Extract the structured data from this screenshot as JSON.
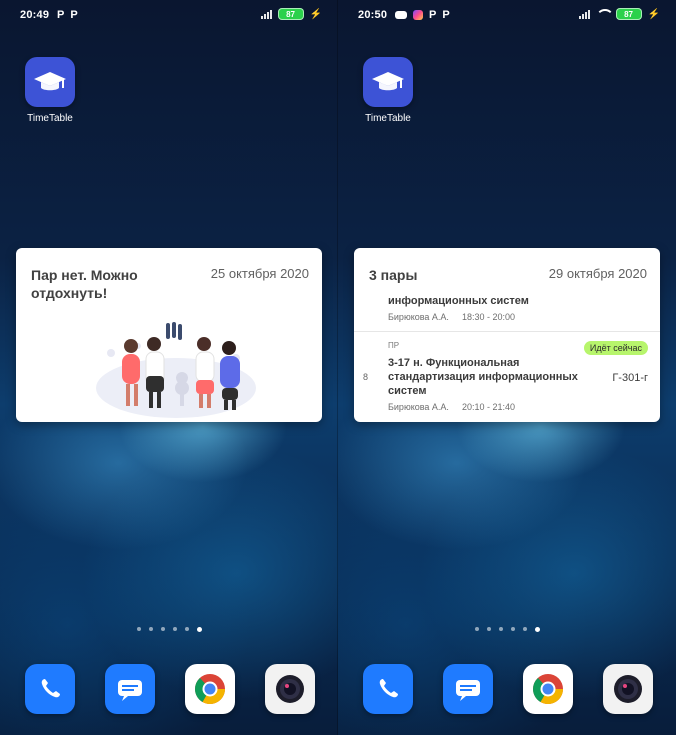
{
  "left_screen": {
    "status": {
      "time": "20:49",
      "battery": "87",
      "notif_icons": [
        "P",
        "P"
      ]
    },
    "app": {
      "label": "TimeTable",
      "icon": "graduation-cap-icon"
    },
    "widget": {
      "title": "Пар нет. Можно отдохнуть!",
      "date": "25 октября 2020",
      "illustration": "celebrating-people-illustration"
    },
    "dock": {
      "apps": [
        "phone-icon",
        "messages-icon",
        "chrome-icon",
        "camera-icon"
      ]
    }
  },
  "right_screen": {
    "status": {
      "time": "20:50",
      "battery": "87",
      "notif_icons": [
        "P",
        "P"
      ]
    },
    "app": {
      "label": "TimeTable",
      "icon": "graduation-cap-icon"
    },
    "widget": {
      "title": "3 пары",
      "date": "29 октября 2020",
      "lessons": [
        {
          "number": "",
          "type": "",
          "subject": "информационных систем",
          "room": "",
          "teacher": "Бирюкова А.А.",
          "time": "18:30 - 20:00"
        },
        {
          "number": "8",
          "type": "ПР",
          "subject": "3-17 н. Функциональная стандартизация информационных систем",
          "room": "Г-301-г",
          "teacher": "Бирюкова А.А.",
          "time": "20:10 - 21:40",
          "badge": "Идёт сейчас"
        }
      ]
    },
    "dock": {
      "apps": [
        "phone-icon",
        "messages-icon",
        "chrome-icon",
        "camera-icon"
      ]
    }
  },
  "colors": {
    "app_icon": "#3d53d6",
    "badge": "#b7f56c",
    "battery": "#2bd14b"
  },
  "home": {
    "page_dots": 6,
    "active_dot": 6
  }
}
